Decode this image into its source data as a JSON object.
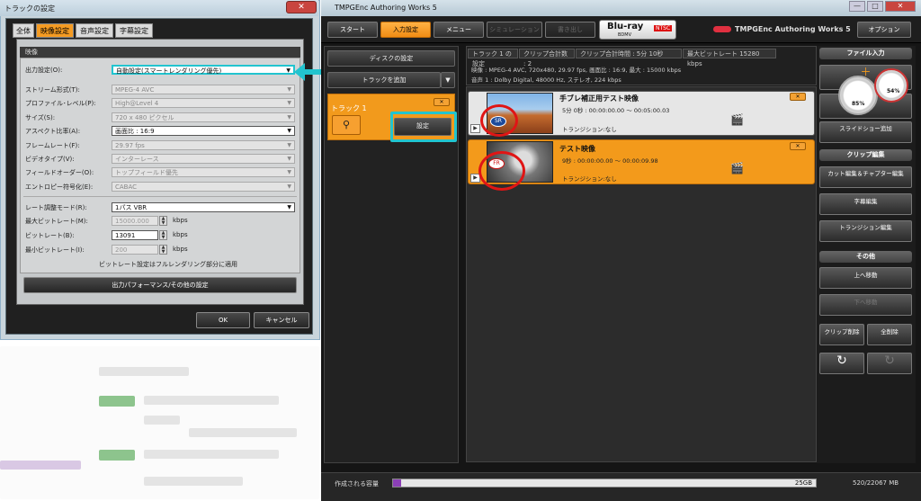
{
  "dialog": {
    "title": "トラックの設定",
    "close": "✕",
    "tabs": [
      "全体",
      "映像設定",
      "音声設定",
      "字幕設定"
    ],
    "section": "映像",
    "fields": [
      {
        "label": "出力設定(O):",
        "value": "自動設定(スマートレンダリング優先)"
      },
      {
        "label": "ストリーム形式(T):",
        "value": "MPEG-4 AVC"
      },
      {
        "label": "プロファイル･レベル(P):",
        "value": "High@Level 4"
      },
      {
        "label": "サイズ(S):",
        "value": "720 x 480 ピクセル"
      },
      {
        "label": "アスペクト比率(A):",
        "value": "画面比 : 16:9"
      },
      {
        "label": "フレームレート(F):",
        "value": "29.97 fps"
      },
      {
        "label": "ビデオタイプ(V):",
        "value": "インターレース"
      },
      {
        "label": "フィールドオーダー(O):",
        "value": "トップフィールド優先"
      },
      {
        "label": "エントロピー符号化(E):",
        "value": "CABAC"
      },
      {
        "label": "レート調整モード(R):",
        "value": "1パス VBR"
      }
    ],
    "rates": [
      {
        "label": "最大ビットレート(M):",
        "value": "15000.000",
        "unit": "kbps"
      },
      {
        "label": "ビットレート(B):",
        "value": "13091",
        "unit": "kbps"
      },
      {
        "label": "最小ビットレート(I):",
        "value": "200",
        "unit": "kbps"
      }
    ],
    "note": "ビットレート設定はフルレンダリング部分に適用",
    "perf_button": "出力パフォーマンス/その他の設定",
    "ok": "OK",
    "cancel": "キャンセル"
  },
  "app": {
    "title": "TMPGEnc Authoring Works 5",
    "win": {
      "min": "—",
      "max": "□",
      "close": "✕"
    },
    "tabs": [
      "スタート",
      "入力設定",
      "メニュー",
      "シミュレーション",
      "書き出し"
    ],
    "bluray": {
      "main": "Blu-ray",
      "sub": "BDMV",
      "std": "NTSC"
    },
    "brand": "TMPGEnc Authoring Works 5",
    "option": "オプション",
    "left": {
      "disc": "ディスクの設定",
      "add_track": "トラックを追加",
      "track": "トラック 1",
      "close": "✕",
      "settings": "設定",
      "zoom_icon": "magnifier-icon"
    },
    "info": {
      "h1": "トラック 1 の設定",
      "h2": "クリップ合計数 : 2",
      "h3": "クリップ合計時間 : 5分 10秒",
      "h4": "最大ビットレート 15280 kbps",
      "video": "映像 :      MPEG-4 AVC, 720x480, 29.97 fps, 画面比 : 16:9, 最大 : 15000 kbps",
      "audio": "音声 1 :    Dolby Digital, 48000 Hz, ステレオ, 224 kbps"
    },
    "clips": [
      {
        "title": "手ブレ補正用テスト映像",
        "duration": "5分 0秒 : 00:00:00.00 ～ 00:05:00.03",
        "transition": "トランジション:なし",
        "badge": "SR"
      },
      {
        "title": "テスト映像",
        "duration": "9秒 : 00:00:00.00 ～ 00:00:09.98",
        "transition": "トランジション:なし",
        "badge": "FR"
      }
    ],
    "right": {
      "file_input": "ファイル入力",
      "slideshow": "スライドショー追加",
      "clip_edit": "クリップ編集",
      "cut": "カット編集＆チャプター編集",
      "subtitle": "字幕編集",
      "transition": "トランジション編集",
      "other": "その他",
      "move_up": "上へ移動",
      "move_down": "下へ移動",
      "del_clip": "クリップ削除",
      "del_all": "全削除",
      "gauge1": "85%",
      "gauge2": "54%"
    },
    "status": {
      "label": "作成される容量",
      "fill": "25GB",
      "total": "520/22067 MB",
      "progress": 0.02
    }
  }
}
